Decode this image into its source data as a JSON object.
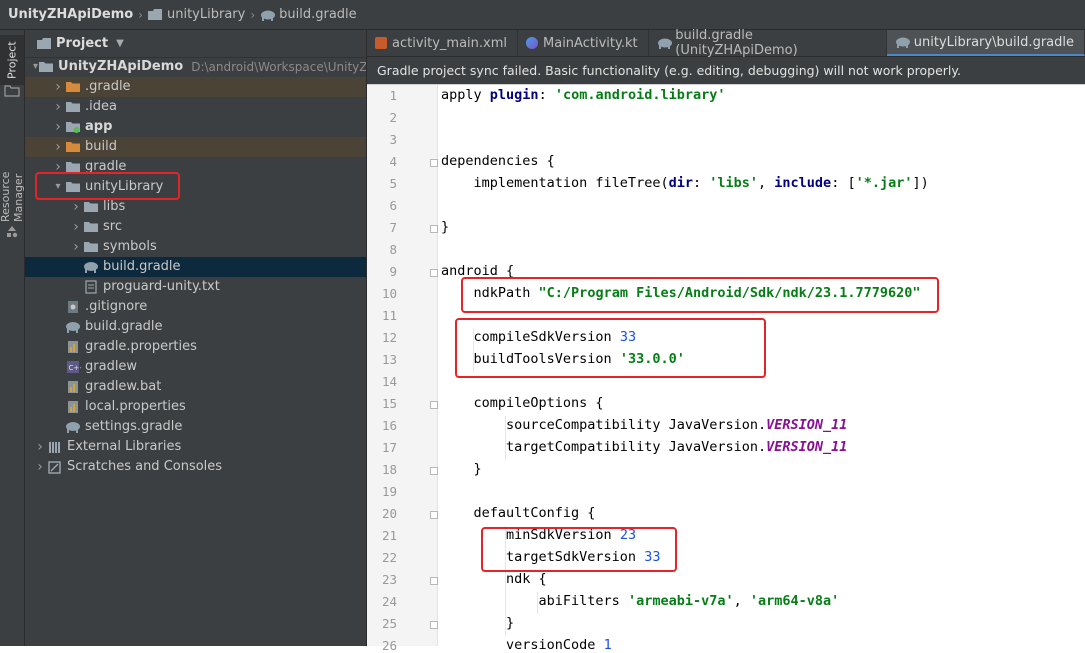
{
  "breadcrumb": [
    "UnityZHApiDemo",
    "unityLibrary",
    "build.gradle"
  ],
  "sidebar_tabs": {
    "project": "Project",
    "resource_manager": "Resource Manager"
  },
  "project_panel": {
    "title": "Project",
    "tree": [
      {
        "label": "UnityZHApiDemo",
        "path": "D:\\android\\Workspace\\UnityZH",
        "depth": 0,
        "expanded": true,
        "icon": "folder-icon"
      },
      {
        "label": ".gradle",
        "depth": 1,
        "expanded": false,
        "icon": "folder-orange-icon"
      },
      {
        "label": ".idea",
        "depth": 1,
        "expanded": false,
        "icon": "folder-icon"
      },
      {
        "label": "app",
        "depth": 1,
        "expanded": false,
        "icon": "module-icon"
      },
      {
        "label": "build",
        "depth": 1,
        "expanded": false,
        "icon": "folder-orange-icon"
      },
      {
        "label": "gradle",
        "depth": 1,
        "expanded": false,
        "icon": "folder-icon"
      },
      {
        "label": "unityLibrary",
        "depth": 1,
        "expanded": true,
        "icon": "folder-icon"
      },
      {
        "label": "libs",
        "depth": 2,
        "expanded": false,
        "icon": "folder-icon"
      },
      {
        "label": "src",
        "depth": 2,
        "expanded": false,
        "icon": "folder-icon"
      },
      {
        "label": "symbols",
        "depth": 2,
        "expanded": false,
        "icon": "folder-icon"
      },
      {
        "label": "build.gradle",
        "depth": 2,
        "icon": "gradle-icon"
      },
      {
        "label": "proguard-unity.txt",
        "depth": 2,
        "icon": "text-file-icon"
      },
      {
        "label": ".gitignore",
        "depth": 1,
        "icon": "gitignore-icon"
      },
      {
        "label": "build.gradle",
        "depth": 1,
        "icon": "gradle-icon"
      },
      {
        "label": "gradle.properties",
        "depth": 1,
        "icon": "properties-icon"
      },
      {
        "label": "gradlew",
        "depth": 1,
        "icon": "script-icon"
      },
      {
        "label": "gradlew.bat",
        "depth": 1,
        "icon": "properties-icon"
      },
      {
        "label": "local.properties",
        "depth": 1,
        "icon": "properties-icon"
      },
      {
        "label": "settings.gradle",
        "depth": 1,
        "icon": "gradle-icon"
      },
      {
        "label": "External Libraries",
        "depth": 0,
        "expanded": false,
        "icon": "libraries-icon"
      },
      {
        "label": "Scratches and Consoles",
        "depth": 0,
        "expanded": false,
        "icon": "scratches-icon"
      }
    ]
  },
  "tabs": [
    {
      "label": "activity_main.xml",
      "icon": "xml-icon"
    },
    {
      "label": "MainActivity.kt",
      "icon": "kotlin-icon"
    },
    {
      "label": "build.gradle (UnityZHApiDemo)",
      "icon": "gradle-icon"
    },
    {
      "label": "unityLibrary\\build.gradle",
      "icon": "gradle-icon",
      "active": true
    }
  ],
  "banner": "Gradle project sync failed. Basic functionality (e.g. editing, debugging) will not work properly.",
  "code_lines": [
    {
      "n": "1",
      "parts": [
        [
          "apply ",
          ""
        ],
        [
          "plugin",
          "kw"
        ],
        [
          ": ",
          ""
        ],
        [
          "'com.android.library'",
          "str"
        ]
      ]
    },
    {
      "n": "2",
      "parts": []
    },
    {
      "n": "3",
      "parts": []
    },
    {
      "n": "4",
      "parts": [
        [
          "dependencies {",
          ""
        ]
      ]
    },
    {
      "n": "5",
      "parts": [
        [
          "    implementation fileTree(",
          ""
        ],
        [
          "dir",
          "kw"
        ],
        [
          ": ",
          ""
        ],
        [
          "'libs'",
          "str"
        ],
        [
          ", ",
          ""
        ],
        [
          "include",
          "kw"
        ],
        [
          ": [",
          ""
        ],
        [
          "'*.jar'",
          "str"
        ],
        [
          "])",
          ""
        ]
      ]
    },
    {
      "n": "6",
      "parts": []
    },
    {
      "n": "7",
      "parts": [
        [
          "}",
          ""
        ]
      ]
    },
    {
      "n": "8",
      "parts": []
    },
    {
      "n": "9",
      "parts": [
        [
          "android {",
          ""
        ]
      ]
    },
    {
      "n": "10",
      "parts": [
        [
          "    ndkPath ",
          ""
        ],
        [
          "\"C:/Program Files/Android/Sdk/ndk/23.1.7779620\"",
          "str"
        ]
      ]
    },
    {
      "n": "11",
      "parts": []
    },
    {
      "n": "12",
      "parts": [
        [
          "    compileSdkVersion ",
          ""
        ],
        [
          "33",
          "num"
        ]
      ]
    },
    {
      "n": "13",
      "parts": [
        [
          "    buildToolsVersion ",
          ""
        ],
        [
          "'33.0.0'",
          "str"
        ]
      ]
    },
    {
      "n": "14",
      "parts": []
    },
    {
      "n": "15",
      "parts": [
        [
          "    compileOptions {",
          ""
        ]
      ]
    },
    {
      "n": "16",
      "parts": [
        [
          "        sourceCompatibility JavaVersion.",
          ""
        ],
        [
          "VERSION_11",
          "itl"
        ]
      ]
    },
    {
      "n": "17",
      "parts": [
        [
          "        targetCompatibility JavaVersion.",
          ""
        ],
        [
          "VERSION_11",
          "itl"
        ]
      ]
    },
    {
      "n": "18",
      "parts": [
        [
          "    }",
          ""
        ]
      ]
    },
    {
      "n": "19",
      "parts": []
    },
    {
      "n": "20",
      "parts": [
        [
          "    defaultConfig {",
          ""
        ]
      ]
    },
    {
      "n": "21",
      "parts": [
        [
          "        minSdkVersion ",
          ""
        ],
        [
          "23",
          "num"
        ]
      ]
    },
    {
      "n": "22",
      "parts": [
        [
          "        targetSdkVersion ",
          ""
        ],
        [
          "33",
          "num"
        ]
      ]
    },
    {
      "n": "23",
      "parts": [
        [
          "        ndk {",
          ""
        ]
      ]
    },
    {
      "n": "24",
      "parts": [
        [
          "            abiFilters ",
          ""
        ],
        [
          "'armeabi-v7a'",
          "str"
        ],
        [
          ", ",
          ""
        ],
        [
          "'arm64-v8a'",
          "str"
        ]
      ]
    },
    {
      "n": "25",
      "parts": [
        [
          "        }",
          ""
        ]
      ]
    },
    {
      "n": "26",
      "parts": [
        [
          "        versionCode ",
          ""
        ],
        [
          "1",
          "num"
        ]
      ]
    }
  ],
  "colors": {
    "annotation_red": "#e5242a",
    "selection_blue": "#0d293e"
  }
}
